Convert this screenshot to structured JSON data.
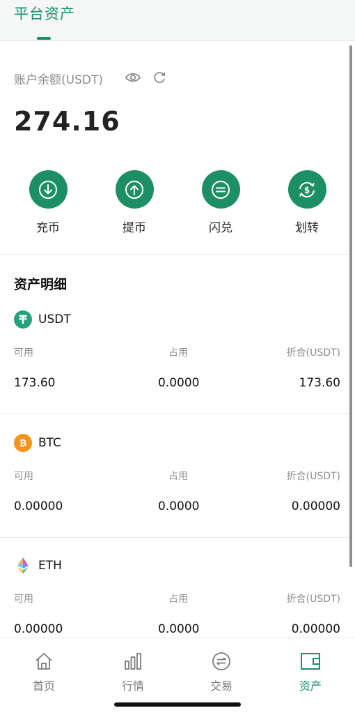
{
  "header": {
    "title": "平台资产"
  },
  "balance": {
    "label": "账户余额(USDT)",
    "value": "274.16"
  },
  "actions": [
    {
      "label": "充币",
      "icon": "deposit-icon"
    },
    {
      "label": "提币",
      "icon": "withdraw-icon"
    },
    {
      "label": "闪兑",
      "icon": "swap-icon"
    },
    {
      "label": "划转",
      "icon": "transfer-icon"
    }
  ],
  "assets": {
    "title": "资产明细",
    "columns": {
      "available": "可用",
      "occupied": "占用",
      "equivalent": "折合(USDT)"
    },
    "items": [
      {
        "symbol": "USDT",
        "available": "173.60",
        "occupied": "0.0000",
        "equivalent": "173.60",
        "color": "#26a17b"
      },
      {
        "symbol": "BTC",
        "available": "0.00000",
        "occupied": "0.0000",
        "equivalent": "0.00000",
        "color": "#f7931a"
      },
      {
        "symbol": "ETH",
        "available": "0.00000",
        "occupied": "0.0000",
        "equivalent": "0.00000",
        "color": "#627eea"
      }
    ]
  },
  "nav": {
    "items": [
      {
        "label": "首页",
        "icon": "home-icon"
      },
      {
        "label": "行情",
        "icon": "market-icon"
      },
      {
        "label": "交易",
        "icon": "trade-icon"
      },
      {
        "label": "资产",
        "icon": "wallet-icon",
        "active": true
      }
    ]
  },
  "colors": {
    "accent": "#1d8f64",
    "muted": "#8a8a8a"
  }
}
